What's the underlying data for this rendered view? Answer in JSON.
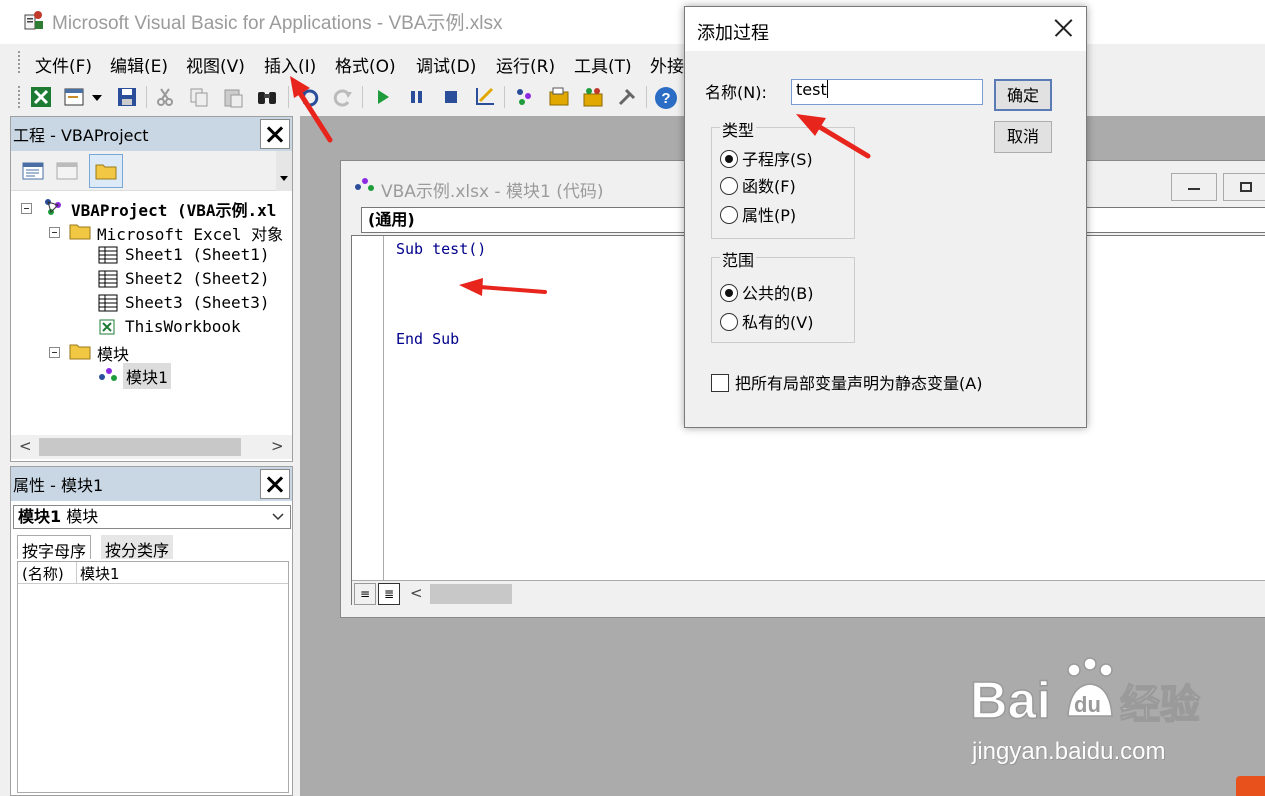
{
  "window": {
    "title": "Microsoft Visual Basic for Applications - VBA示例.xlsx"
  },
  "menu": [
    "文件(F)",
    "编辑(E)",
    "视图(V)",
    "插入(I)",
    "格式(O)",
    "调试(D)",
    "运行(R)",
    "工具(T)",
    "外接"
  ],
  "project": {
    "title": "工程 - VBAProject",
    "tree": {
      "root": "VBAProject (VBA示例.xl",
      "excel_objects": "Microsoft Excel 对象",
      "sheets": [
        "Sheet1 (Sheet1)",
        "Sheet2 (Sheet2)",
        "Sheet3 (Sheet3)",
        "ThisWorkbook"
      ],
      "modules_folder": "模块",
      "module": "模块1"
    }
  },
  "properties": {
    "title": "属性 - 模块1",
    "object_name": "模块1",
    "object_type": "模块",
    "tabs": [
      "按字母序",
      "按分类序"
    ],
    "rows": [
      {
        "name": "(名称)",
        "value": "模块1"
      }
    ]
  },
  "code_window": {
    "title": "VBA示例.xlsx - 模块1 (代码)",
    "object_combo": "(通用)",
    "lines": [
      "Sub test()",
      "End Sub"
    ]
  },
  "dialog": {
    "title": "添加过程",
    "name_label": "名称(N):",
    "name_value": "test",
    "ok": "确定",
    "cancel": "取消",
    "type_group": {
      "label": "类型",
      "options": [
        {
          "label": "子程序(S)",
          "checked": true
        },
        {
          "label": "函数(F)",
          "checked": false
        },
        {
          "label": "属性(P)",
          "checked": false
        }
      ]
    },
    "scope_group": {
      "label": "范围",
      "options": [
        {
          "label": "公共的(B)",
          "checked": true
        },
        {
          "label": "私有的(V)",
          "checked": false
        }
      ]
    },
    "static_checkbox": {
      "label": "把所有局部变量声明为静态变量(A)",
      "checked": false
    }
  },
  "watermark": {
    "logo": "Bai经验",
    "url": "jingyan.baidu.com"
  },
  "colors": {
    "arrow": "#e8251c",
    "pane_header": "#c9d7e4",
    "workspace": "#ababab",
    "code_keyword": "#00008b"
  },
  "icons": [
    "excel-icon",
    "insert-userform-icon",
    "save-icon",
    "cut-icon",
    "copy-icon",
    "paste-icon",
    "find-icon",
    "undo-icon",
    "redo-icon",
    "run-icon",
    "break-icon",
    "reset-icon",
    "design-mode-icon",
    "project-explorer-icon",
    "properties-icon",
    "object-browser-icon",
    "toolbox-icon",
    "help-icon"
  ]
}
